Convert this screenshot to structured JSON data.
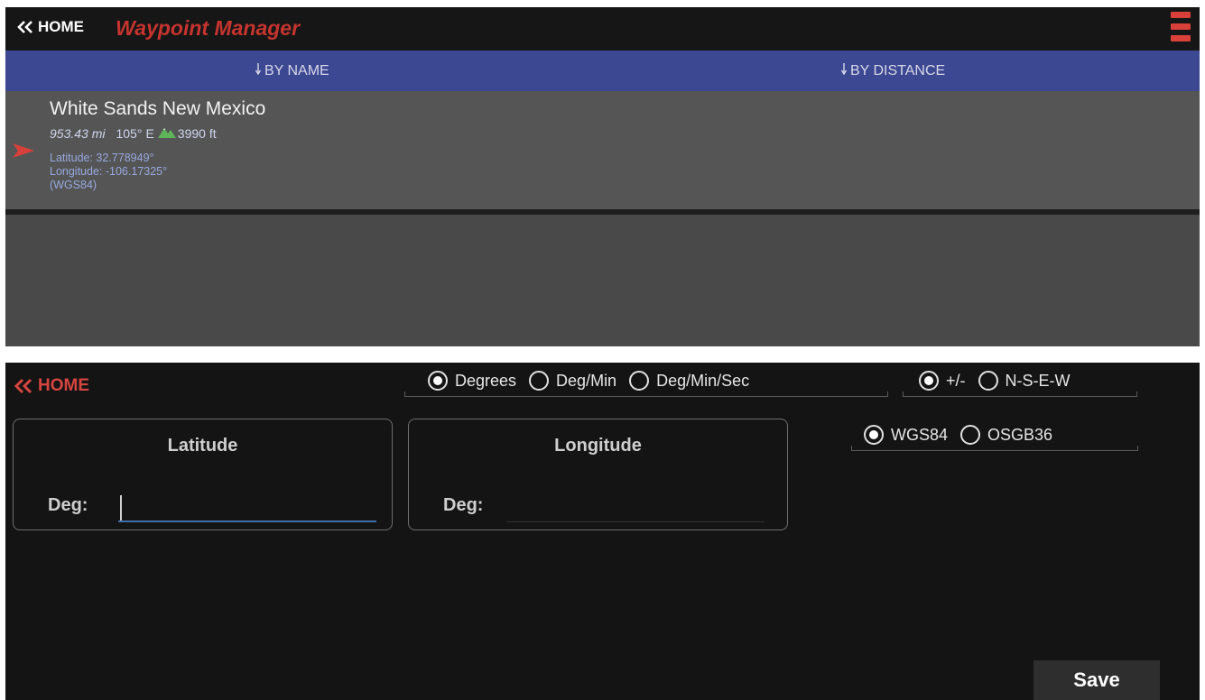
{
  "waypoint_list": {
    "home_label": "HOME",
    "title": "Waypoint Manager",
    "sort": {
      "by_name": "BY NAME",
      "by_distance": "BY DISTANCE"
    },
    "waypoints": [
      {
        "name": "White Sands New Mexico",
        "distance": "953.43 mi",
        "bearing": "105°",
        "direction": "E",
        "elevation": "3990 ft",
        "latitude": "Latitude: 32.778949°",
        "longitude": "Longitude: -106.17325°",
        "datum": "(WGS84)"
      }
    ]
  },
  "coordinate_entry": {
    "home_label": "HOME",
    "format_options": [
      {
        "label": "Degrees",
        "checked": true
      },
      {
        "label": "Deg/Min",
        "checked": false
      },
      {
        "label": "Deg/Min/Sec",
        "checked": false
      }
    ],
    "sign_options": [
      {
        "label": "+/-",
        "checked": true
      },
      {
        "label": "N-S-E-W",
        "checked": false
      }
    ],
    "datum_options": [
      {
        "label": "WGS84",
        "checked": true
      },
      {
        "label": "OSGB36",
        "checked": false
      }
    ],
    "latitude": {
      "title": "Latitude",
      "deg_label": "Deg:",
      "value": ""
    },
    "longitude": {
      "title": "Longitude",
      "deg_label": "Deg:",
      "value": ""
    },
    "save_label": "Save"
  },
  "colors": {
    "accent_red": "#c5342e",
    "sort_bar_blue": "#3d4892",
    "elevation_icon_green": "#5fb35a"
  },
  "icons": [
    "double-chevron-left-icon",
    "hamburger-menu-icon",
    "down-arrow-icon",
    "mountain-icon",
    "pointer-arrow-icon",
    "radio-button-icon"
  ]
}
